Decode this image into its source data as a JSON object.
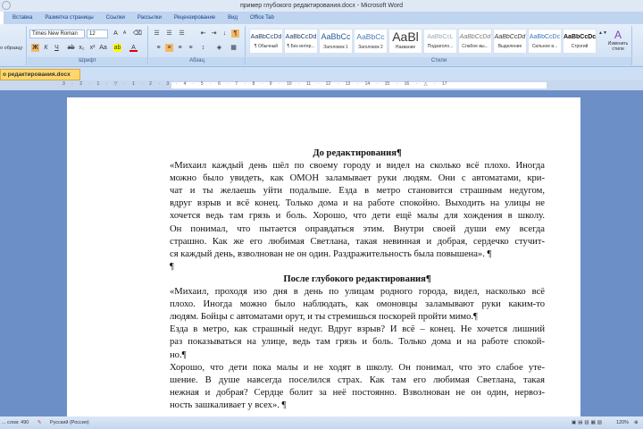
{
  "window": {
    "title": "пример глубокого редактирования.docx - Microsoft Word"
  },
  "tabs": [
    "Вставка",
    "Разметка страницы",
    "Ссылки",
    "Рассылки",
    "Рецензирование",
    "Вид",
    "Office Tab"
  ],
  "ribbon": {
    "clipboard": {
      "format_painter": "о образцу"
    },
    "font": {
      "name": "Times New Roman",
      "size": "12",
      "label": "Шрифт"
    },
    "paragraph": {
      "label": "Абзац"
    },
    "styles": {
      "label": "Стили",
      "items": [
        {
          "preview": "AaBbCcDd",
          "name": "¶ Обычный"
        },
        {
          "preview": "AaBbCcDd",
          "name": "¶ Без интер..."
        },
        {
          "preview": "AaBbCc",
          "name": "Заголовок 1"
        },
        {
          "preview": "AaBbCc",
          "name": "Заголовок 2"
        },
        {
          "preview": "AaBl",
          "name": "Название"
        },
        {
          "preview": "AaBbCcL",
          "name": "Подзаголо..."
        },
        {
          "preview": "AaBbCcDd",
          "name": "Слабое вы..."
        },
        {
          "preview": "AaBbCcDd",
          "name": "Выделение"
        },
        {
          "preview": "AaBbCcDc",
          "name": "Сильное в..."
        },
        {
          "preview": "AaBbCcDc",
          "name": "Строгий"
        }
      ],
      "change": "Изменить стили"
    }
  },
  "doc_tab": "о редактирования.docx",
  "ruler": "3 · 2 · 1 · ▽ · 1 · 2 · 3 · 4 · 5 · 6 · 7 · 8 · 9 · 10 · 11 · 12 · 13 · 14 · 15 · 16 · △ · 17",
  "document": {
    "heading1": "До редактирования¶",
    "before": [
      "«Михаил каждый день шёл по своему городу и видел на сколько всё плохо. Иногда",
      "можно было увидеть, как ОМОН заламывает руки людям. Они с автоматами, кри-",
      "чат и ты желаешь уйти подальше. Езда в метро становится страшным недугом,",
      "вдруг взрыв и всё конец. Только дома и на работе спокойно. Выходить на улицы не",
      "хочется ведь там грязь и боль. Хорошо, что дети ещё малы для хождения в школу.",
      "Он понимал, что пытается оправдаться этим. Внутри своей души ему всегда",
      "страшно. Как же его любимая Светлана, такая невинная и добрая, сердечко стучит-",
      "ся каждый день, взволнован не он один. Раздражительность была повышена». ¶"
    ],
    "empty_para": "¶",
    "heading2": "После глубокого редактирования¶",
    "after": [
      "«Михаил, проходя изо дня в день по улицам родного города, видел, насколько всё",
      "плохо. Иногда можно было наблюдать, как омоновцы заламывают руки каким-то",
      "людям. Бойцы с автоматами орут, и ты стремишься поскорей пройти мимо.¶",
      "Езда в метро, как страшный недуг. Вдруг взрыв? И всё – конец. Не хочется лишний",
      "раз показываться на улице, ведь там грязь и боль. Только дома и на работе спокой-",
      "но.¶",
      "Хорошо, что дети пока малы и не ходят в школу. Он понимал, что это слабое уте-",
      "шение. В душе навсегда поселился страх. Как там его любимая Светлана, такая",
      "нежная и добрая? Сердце болит за неё постоянно. Взволнован не он один, нервоз-",
      "ность зашкаливает у всех». ¶"
    ]
  },
  "status": {
    "words": "... слов: 490",
    "language": "Русский (Россия)",
    "zoom": "120%"
  }
}
